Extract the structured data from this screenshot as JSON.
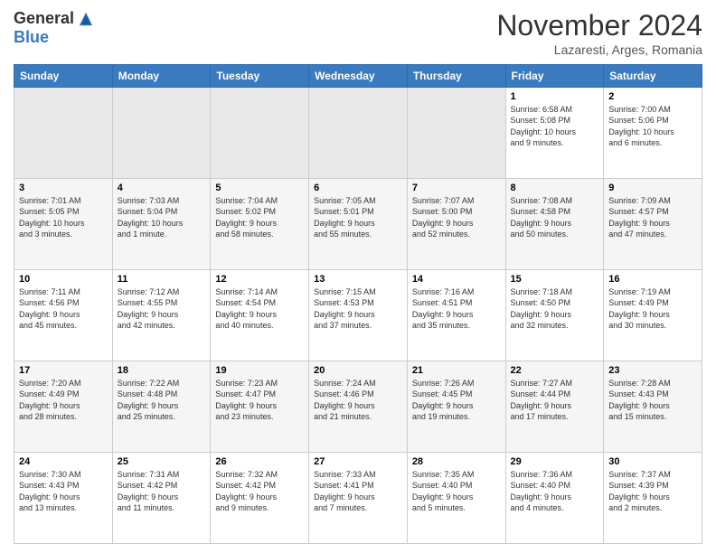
{
  "logo": {
    "general": "General",
    "blue": "Blue"
  },
  "title": "November 2024",
  "subtitle": "Lazaresti, Arges, Romania",
  "days_of_week": [
    "Sunday",
    "Monday",
    "Tuesday",
    "Wednesday",
    "Thursday",
    "Friday",
    "Saturday"
  ],
  "weeks": [
    {
      "row_class": "row-white",
      "days": [
        {
          "num": "",
          "info": ""
        },
        {
          "num": "",
          "info": ""
        },
        {
          "num": "",
          "info": ""
        },
        {
          "num": "",
          "info": ""
        },
        {
          "num": "",
          "info": ""
        },
        {
          "num": "1",
          "info": "Sunrise: 6:58 AM\nSunset: 5:08 PM\nDaylight: 10 hours\nand 9 minutes."
        },
        {
          "num": "2",
          "info": "Sunrise: 7:00 AM\nSunset: 5:06 PM\nDaylight: 10 hours\nand 6 minutes."
        }
      ]
    },
    {
      "row_class": "row-gray",
      "days": [
        {
          "num": "3",
          "info": "Sunrise: 7:01 AM\nSunset: 5:05 PM\nDaylight: 10 hours\nand 3 minutes."
        },
        {
          "num": "4",
          "info": "Sunrise: 7:03 AM\nSunset: 5:04 PM\nDaylight: 10 hours\nand 1 minute."
        },
        {
          "num": "5",
          "info": "Sunrise: 7:04 AM\nSunset: 5:02 PM\nDaylight: 9 hours\nand 58 minutes."
        },
        {
          "num": "6",
          "info": "Sunrise: 7:05 AM\nSunset: 5:01 PM\nDaylight: 9 hours\nand 55 minutes."
        },
        {
          "num": "7",
          "info": "Sunrise: 7:07 AM\nSunset: 5:00 PM\nDaylight: 9 hours\nand 52 minutes."
        },
        {
          "num": "8",
          "info": "Sunrise: 7:08 AM\nSunset: 4:58 PM\nDaylight: 9 hours\nand 50 minutes."
        },
        {
          "num": "9",
          "info": "Sunrise: 7:09 AM\nSunset: 4:57 PM\nDaylight: 9 hours\nand 47 minutes."
        }
      ]
    },
    {
      "row_class": "row-white",
      "days": [
        {
          "num": "10",
          "info": "Sunrise: 7:11 AM\nSunset: 4:56 PM\nDaylight: 9 hours\nand 45 minutes."
        },
        {
          "num": "11",
          "info": "Sunrise: 7:12 AM\nSunset: 4:55 PM\nDaylight: 9 hours\nand 42 minutes."
        },
        {
          "num": "12",
          "info": "Sunrise: 7:14 AM\nSunset: 4:54 PM\nDaylight: 9 hours\nand 40 minutes."
        },
        {
          "num": "13",
          "info": "Sunrise: 7:15 AM\nSunset: 4:53 PM\nDaylight: 9 hours\nand 37 minutes."
        },
        {
          "num": "14",
          "info": "Sunrise: 7:16 AM\nSunset: 4:51 PM\nDaylight: 9 hours\nand 35 minutes."
        },
        {
          "num": "15",
          "info": "Sunrise: 7:18 AM\nSunset: 4:50 PM\nDaylight: 9 hours\nand 32 minutes."
        },
        {
          "num": "16",
          "info": "Sunrise: 7:19 AM\nSunset: 4:49 PM\nDaylight: 9 hours\nand 30 minutes."
        }
      ]
    },
    {
      "row_class": "row-gray",
      "days": [
        {
          "num": "17",
          "info": "Sunrise: 7:20 AM\nSunset: 4:49 PM\nDaylight: 9 hours\nand 28 minutes."
        },
        {
          "num": "18",
          "info": "Sunrise: 7:22 AM\nSunset: 4:48 PM\nDaylight: 9 hours\nand 25 minutes."
        },
        {
          "num": "19",
          "info": "Sunrise: 7:23 AM\nSunset: 4:47 PM\nDaylight: 9 hours\nand 23 minutes."
        },
        {
          "num": "20",
          "info": "Sunrise: 7:24 AM\nSunset: 4:46 PM\nDaylight: 9 hours\nand 21 minutes."
        },
        {
          "num": "21",
          "info": "Sunrise: 7:26 AM\nSunset: 4:45 PM\nDaylight: 9 hours\nand 19 minutes."
        },
        {
          "num": "22",
          "info": "Sunrise: 7:27 AM\nSunset: 4:44 PM\nDaylight: 9 hours\nand 17 minutes."
        },
        {
          "num": "23",
          "info": "Sunrise: 7:28 AM\nSunset: 4:43 PM\nDaylight: 9 hours\nand 15 minutes."
        }
      ]
    },
    {
      "row_class": "row-white",
      "days": [
        {
          "num": "24",
          "info": "Sunrise: 7:30 AM\nSunset: 4:43 PM\nDaylight: 9 hours\nand 13 minutes."
        },
        {
          "num": "25",
          "info": "Sunrise: 7:31 AM\nSunset: 4:42 PM\nDaylight: 9 hours\nand 11 minutes."
        },
        {
          "num": "26",
          "info": "Sunrise: 7:32 AM\nSunset: 4:42 PM\nDaylight: 9 hours\nand 9 minutes."
        },
        {
          "num": "27",
          "info": "Sunrise: 7:33 AM\nSunset: 4:41 PM\nDaylight: 9 hours\nand 7 minutes."
        },
        {
          "num": "28",
          "info": "Sunrise: 7:35 AM\nSunset: 4:40 PM\nDaylight: 9 hours\nand 5 minutes."
        },
        {
          "num": "29",
          "info": "Sunrise: 7:36 AM\nSunset: 4:40 PM\nDaylight: 9 hours\nand 4 minutes."
        },
        {
          "num": "30",
          "info": "Sunrise: 7:37 AM\nSunset: 4:39 PM\nDaylight: 9 hours\nand 2 minutes."
        }
      ]
    }
  ]
}
